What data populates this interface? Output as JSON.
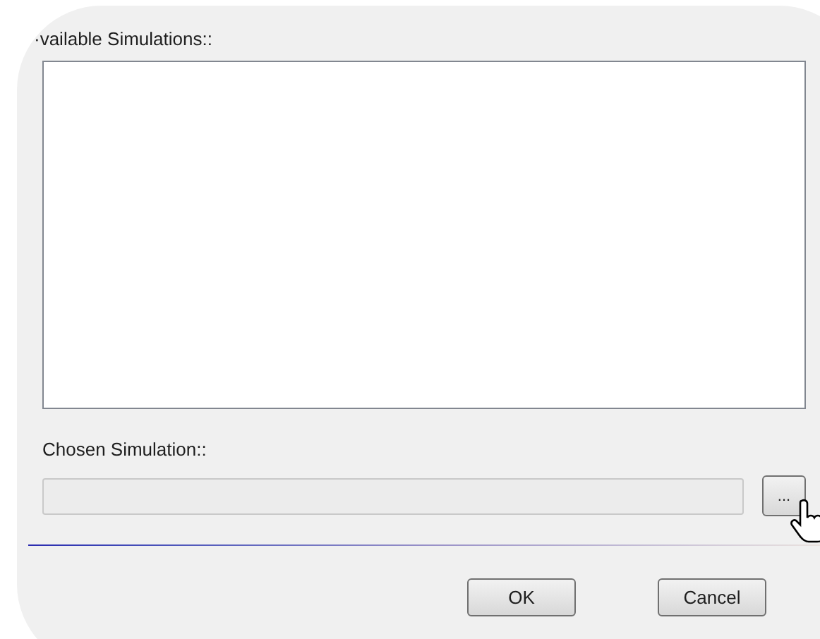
{
  "available_label": "·vailable Simulations::",
  "chosen_label": "Chosen Simulation::",
  "chosen_field": {
    "disabled": true
  },
  "browse_button": "...",
  "buttons": [
    "OK",
    "Cancel"
  ]
}
